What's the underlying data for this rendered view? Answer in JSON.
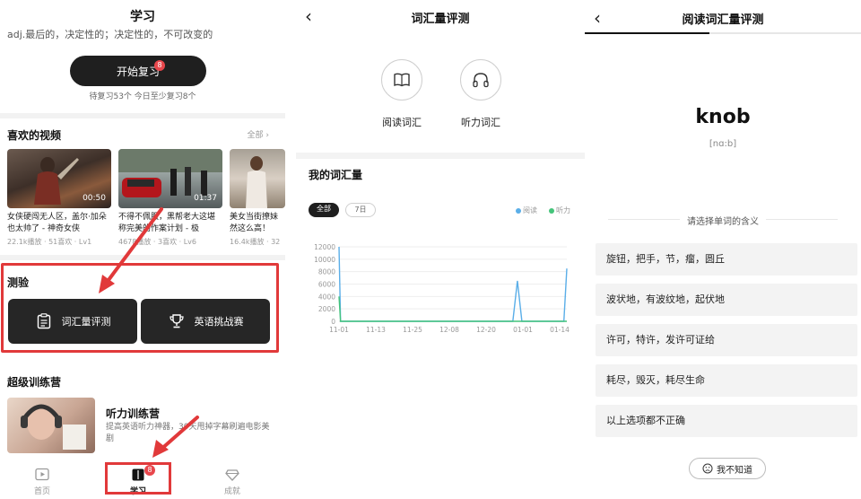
{
  "study": {
    "header_title": "学习",
    "cut_text": "adj.最后的，决定性的；决定性的，不可改变的",
    "review_button_label": "开始复习",
    "review_badge": "8",
    "review_stats": "待复习53个   今日至少复习8个",
    "favorites": {
      "title": "喜欢的视频",
      "see_all": "全部",
      "videos": [
        {
          "duration": "00:50",
          "title": "女侠硬闯无人区，盖尔·加朵也太帅了 - 神奇女侠",
          "meta": "22.1k播放 · 51喜欢 · Lv1"
        },
        {
          "duration": "01:37",
          "title": "不得不佩服，黑帮老大这堪称完美的作案计划 - 极",
          "meta": "4678播放 · 3喜欢 · Lv6"
        },
        {
          "duration": "",
          "title": "美女当街撩妹然这么高！",
          "meta": "16.4k播放 · 32"
        }
      ]
    },
    "quiz": {
      "title": "测验",
      "vocab_btn": "词汇量评测",
      "challenge_btn": "英语挑战赛"
    },
    "camp": {
      "title": "超级训练营",
      "item_title": "听力训练营",
      "item_desc": "提高英语听力神器，30天甩掉字幕刷遍电影美剧"
    },
    "tabs": {
      "home": "首页",
      "study": "学习",
      "study_badge": "8",
      "achieve": "成就"
    }
  },
  "vocab_test": {
    "title": "词汇量评测",
    "modes": [
      {
        "label": "阅读词汇",
        "icon": "book-icon"
      },
      {
        "label": "听力词汇",
        "icon": "headphones-icon"
      }
    ],
    "my_vocab_title": "我的词汇量",
    "filters": [
      "全部",
      "7日"
    ],
    "legend": [
      {
        "name": "阅读",
        "color": "#5aaee8"
      },
      {
        "name": "听力",
        "color": "#44c47a"
      }
    ]
  },
  "reading_test": {
    "title": "阅读词汇量评测",
    "progress": 0.45,
    "word": "knob",
    "phonetic": "[nɑ:b]",
    "prompt": "请选择单词的含义",
    "options": [
      "旋钮，把手，节，瘤，圆丘",
      "波状地，有波纹地，起伏地",
      "许可，特许，发许可证给",
      "耗尽，毁灭，耗尽生命",
      "以上选项都不正确"
    ],
    "dont_know": "我不知道"
  },
  "chart_data": {
    "type": "line",
    "title": "",
    "xlabel": "",
    "ylabel": "",
    "x_ticks": [
      "11-01",
      "11-13",
      "11-25",
      "12-08",
      "12-20",
      "01-01",
      "01-14"
    ],
    "y_ticks": [
      "12000",
      "10000",
      "8000",
      "6000",
      "4000",
      "2000",
      "0"
    ],
    "ylim": [
      0,
      12000
    ],
    "x_range_days": [
      0,
      76
    ],
    "series": [
      {
        "name": "阅读",
        "color": "#5aaee8",
        "points": [
          [
            0,
            12000
          ],
          [
            0.5,
            0
          ],
          [
            58,
            0
          ],
          [
            59.5,
            6500
          ],
          [
            61,
            0
          ],
          [
            75,
            0
          ],
          [
            76,
            8500
          ]
        ]
      },
      {
        "name": "听力",
        "color": "#44c47a",
        "points": [
          [
            0,
            4000
          ],
          [
            0.5,
            0
          ],
          [
            76,
            0
          ]
        ]
      }
    ],
    "grid": true,
    "legend_position": "top-right"
  }
}
